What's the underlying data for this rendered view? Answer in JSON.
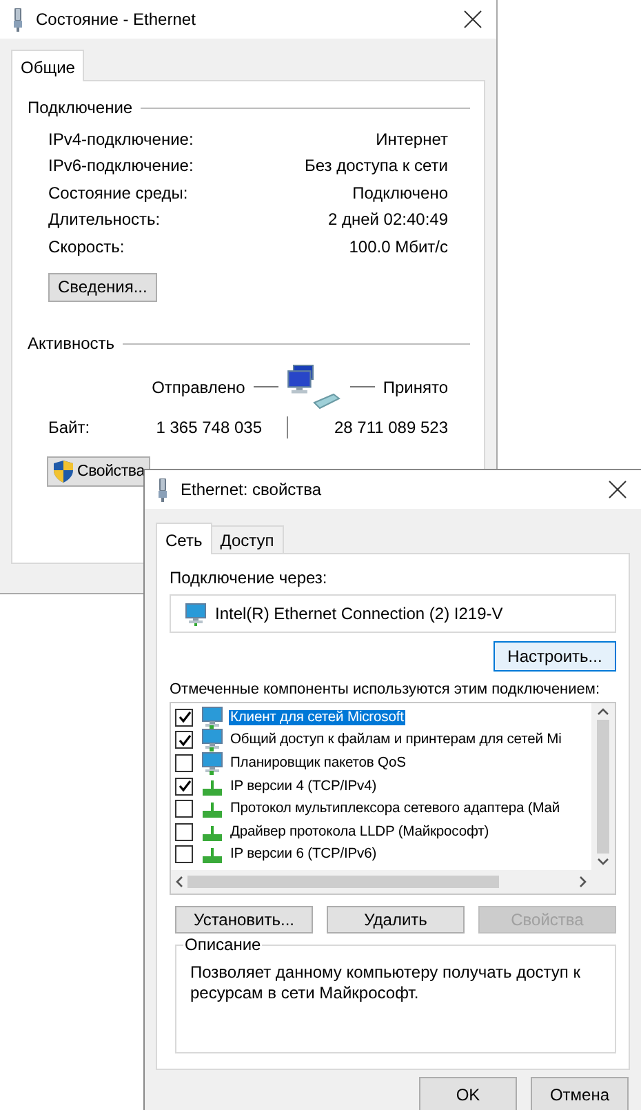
{
  "status_window": {
    "title": "Состояние - Ethernet",
    "tabs": [
      {
        "label": "Общие",
        "selected": true
      }
    ],
    "connection": {
      "heading": "Подключение",
      "rows": [
        {
          "label": "IPv4-подключение:",
          "value": "Интернет"
        },
        {
          "label": "IPv6-подключение:",
          "value": "Без доступа к сети"
        },
        {
          "label": "Состояние среды:",
          "value": "Подключено"
        },
        {
          "label": "Длительность:",
          "value": "2 дней 02:40:49"
        },
        {
          "label": "Скорость:",
          "value": "100.0 Мбит/с"
        }
      ]
    },
    "details_button": "Сведения...",
    "activity": {
      "heading": "Активность",
      "sent_label": "Отправлено",
      "received_label": "Принято",
      "bytes_label": "Байт:",
      "bytes_sent": "1 365 748 035",
      "bytes_received": "28 711 089 523"
    },
    "properties_button": "Свойства"
  },
  "properties_window": {
    "title": "Ethernet: свойства",
    "tabs": [
      {
        "label": "Сеть",
        "selected": true
      },
      {
        "label": "Доступ",
        "selected": false
      }
    ],
    "connect_using_label": "Подключение через:",
    "adapter": "Intel(R) Ethernet Connection (2) I219-V",
    "configure_button": "Настроить...",
    "components_label": "Отмеченные компоненты используются этим подключением:",
    "components": [
      {
        "label": "Клиент для сетей Microsoft",
        "checked": true,
        "selected": true,
        "kind": "client"
      },
      {
        "label": "Общий доступ к файлам и принтерам для сетей Mi",
        "checked": true,
        "selected": false,
        "kind": "client"
      },
      {
        "label": "Планировщик пакетов QoS",
        "checked": false,
        "selected": false,
        "kind": "client"
      },
      {
        "label": "IP версии 4 (TCP/IPv4)",
        "checked": true,
        "selected": false,
        "kind": "protocol"
      },
      {
        "label": "Протокол мультиплексора сетевого адаптера (Май",
        "checked": false,
        "selected": false,
        "kind": "protocol"
      },
      {
        "label": "Драйвер протокола LLDP (Майкрософт)",
        "checked": false,
        "selected": false,
        "kind": "protocol"
      },
      {
        "label": "IP версии 6 (TCP/IPv6)",
        "checked": false,
        "selected": false,
        "kind": "protocol"
      }
    ],
    "buttons": [
      {
        "label": "Установить...",
        "disabled": false
      },
      {
        "label": "Удалить",
        "disabled": false
      },
      {
        "label": "Свойства",
        "disabled": true
      }
    ],
    "description": {
      "heading": "Описание",
      "text": "Позволяет данному компьютеру получать доступ к ресурсам в сети Майкрософт."
    },
    "footer_buttons": [
      "OK",
      "Отмена"
    ]
  }
}
